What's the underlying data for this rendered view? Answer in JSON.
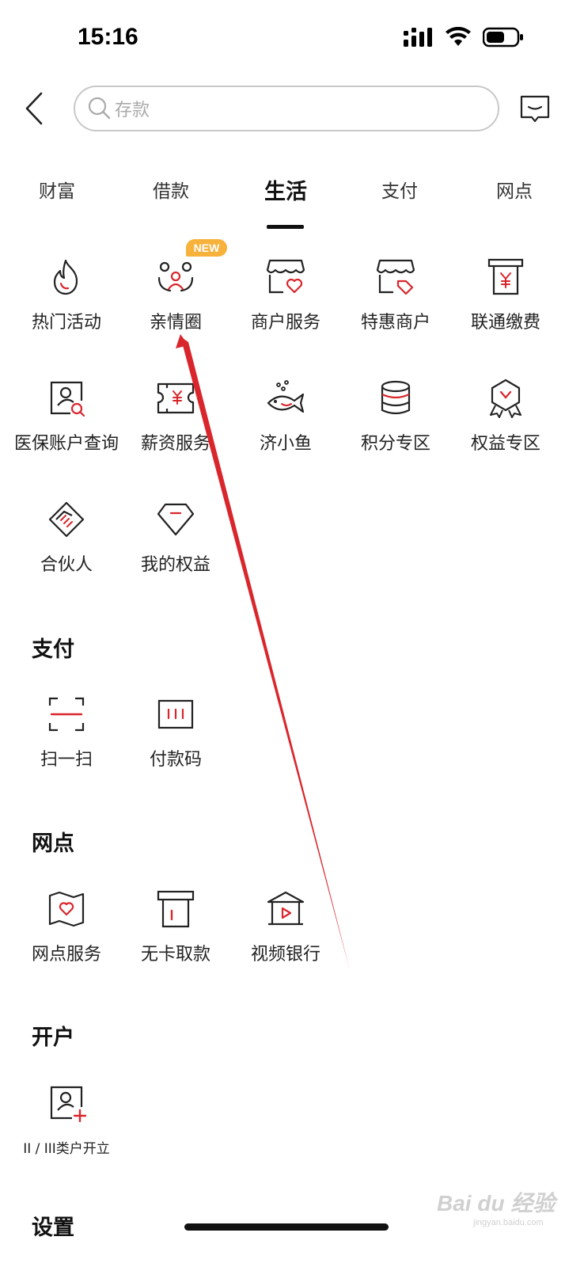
{
  "status": {
    "time": "15:16"
  },
  "search": {
    "placeholder": "存款"
  },
  "tabs": [
    {
      "label": "财富"
    },
    {
      "label": "借款"
    },
    {
      "label": "生活"
    },
    {
      "label": "支付"
    },
    {
      "label": "网点"
    }
  ],
  "life": {
    "badge": "NEW",
    "items": [
      {
        "label": "热门活动",
        "icon": "flame-icon"
      },
      {
        "label": "亲情圈",
        "icon": "family-icon"
      },
      {
        "label": "商户服务",
        "icon": "store-heart-icon"
      },
      {
        "label": "特惠商户",
        "icon": "store-tag-icon"
      },
      {
        "label": "联通缴费",
        "icon": "bill-yuan-icon"
      },
      {
        "label": "医保账户查询",
        "icon": "medical-account-icon"
      },
      {
        "label": "薪资服务",
        "icon": "salary-ticket-icon"
      },
      {
        "label": "济小鱼",
        "icon": "fish-icon"
      },
      {
        "label": "积分专区",
        "icon": "points-coins-icon"
      },
      {
        "label": "权益专区",
        "icon": "rights-medal-icon"
      },
      {
        "label": "合伙人",
        "icon": "handshake-icon"
      },
      {
        "label": "我的权益",
        "icon": "diamond-icon"
      }
    ]
  },
  "pay": {
    "title": "支付",
    "items": [
      {
        "label": "扫一扫",
        "icon": "scan-icon"
      },
      {
        "label": "付款码",
        "icon": "payment-code-icon"
      }
    ]
  },
  "branch": {
    "title": "网点",
    "items": [
      {
        "label": "网点服务",
        "icon": "map-heart-icon"
      },
      {
        "label": "无卡取款",
        "icon": "atm-withdraw-icon"
      },
      {
        "label": "视频银行",
        "icon": "video-bank-icon"
      }
    ]
  },
  "account": {
    "title": "开户",
    "items": [
      {
        "label": "II / III类户开立",
        "icon": "account-add-icon"
      }
    ]
  },
  "settings": {
    "title": "设置"
  },
  "watermark": {
    "text": "Bai du 经验",
    "sub": "jingyan.baidu.com"
  },
  "colors": {
    "accent": "#d9262c",
    "badge": "#f7b23b",
    "text": "#222222"
  }
}
